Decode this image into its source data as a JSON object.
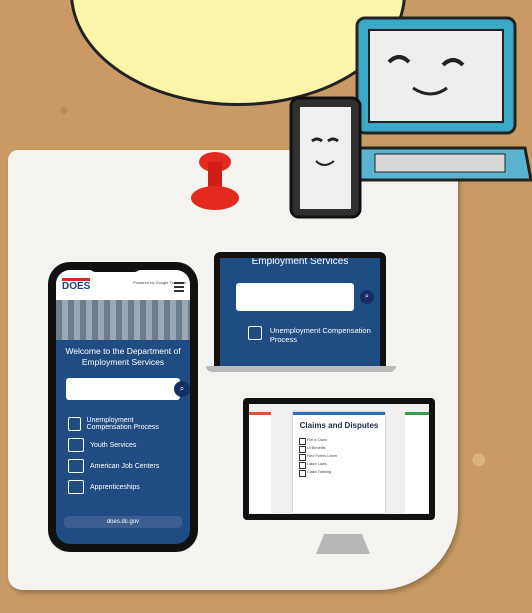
{
  "phone": {
    "topline": "Powered by Google Translate",
    "logo": "DOES",
    "welcome": "Welcome to the Department of Employment Services",
    "menu": [
      {
        "label": "Unemployment Compensation Process"
      },
      {
        "label": "Youth Services"
      },
      {
        "label": "American Job Centers"
      },
      {
        "label": "Apprenticeships"
      }
    ],
    "url": "does.dc.gov"
  },
  "tablet": {
    "heading": "Employment Services",
    "item": "Unemployment Compensation Process"
  },
  "desktop": {
    "card_title": "Claims and Disputes",
    "items": [
      "File a Claim",
      "UI Benefits",
      "Find Forms Learn",
      "Labor Laws",
      "Claim Training"
    ]
  }
}
